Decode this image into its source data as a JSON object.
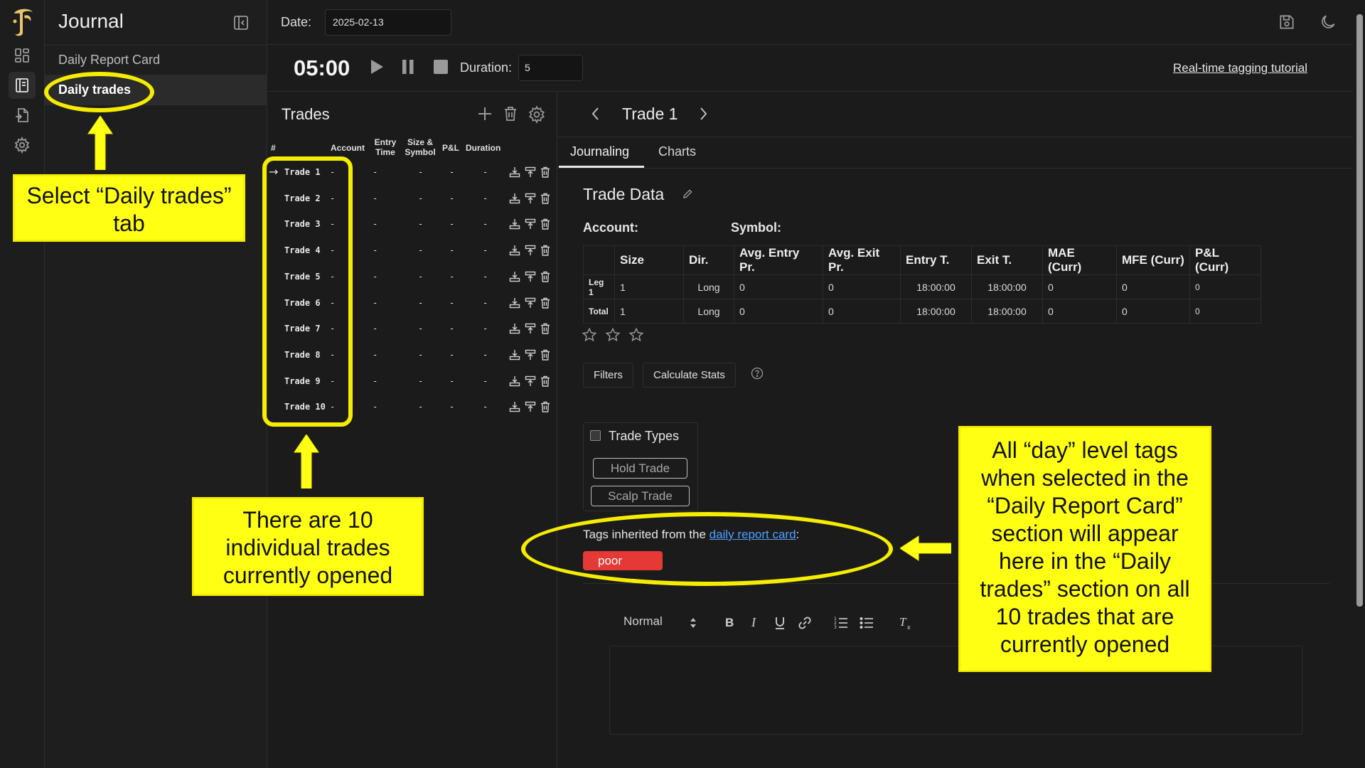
{
  "app": {
    "title": "Journal"
  },
  "sidebar": {
    "items": [
      {
        "label": "Daily Report Card"
      },
      {
        "label": "Daily trades"
      }
    ]
  },
  "topbar": {
    "date_label": "Date:",
    "date_value": "2025-02-13"
  },
  "timer": {
    "time": "05:00",
    "duration_label": "Duration:",
    "duration_value": "5",
    "tutorial_link": "Real-time tagging tutorial"
  },
  "trades_panel": {
    "title": "Trades",
    "columns": [
      "#",
      "Account",
      "Entry Time",
      "Size & Symbol",
      "P&L",
      "Duration"
    ],
    "rows": [
      {
        "name": "Trade 1",
        "account": "-",
        "entry": "-",
        "size": "-",
        "pnl": "-",
        "duration": "-"
      },
      {
        "name": "Trade 2",
        "account": "-",
        "entry": "-",
        "size": "-",
        "pnl": "-",
        "duration": "-"
      },
      {
        "name": "Trade 3",
        "account": "-",
        "entry": "-",
        "size": "-",
        "pnl": "-",
        "duration": "-"
      },
      {
        "name": "Trade 4",
        "account": "-",
        "entry": "-",
        "size": "-",
        "pnl": "-",
        "duration": "-"
      },
      {
        "name": "Trade 5",
        "account": "-",
        "entry": "-",
        "size": "-",
        "pnl": "-",
        "duration": "-"
      },
      {
        "name": "Trade 6",
        "account": "-",
        "entry": "-",
        "size": "-",
        "pnl": "-",
        "duration": "-"
      },
      {
        "name": "Trade 7",
        "account": "-",
        "entry": "-",
        "size": "-",
        "pnl": "-",
        "duration": "-"
      },
      {
        "name": "Trade 8",
        "account": "-",
        "entry": "-",
        "size": "-",
        "pnl": "-",
        "duration": "-"
      },
      {
        "name": "Trade 9",
        "account": "-",
        "entry": "-",
        "size": "-",
        "pnl": "-",
        "duration": "-"
      },
      {
        "name": "Trade 10",
        "account": "-",
        "entry": "-",
        "size": "-",
        "pnl": "-",
        "duration": "-"
      }
    ],
    "current_marker": "→"
  },
  "trade_detail": {
    "title": "Trade 1",
    "tabs": [
      "Journaling",
      "Charts"
    ],
    "section_title": "Trade Data",
    "account_label": "Account:",
    "symbol_label": "Symbol:",
    "table": {
      "headers": [
        "Size",
        "Dir.",
        "Avg. Entry Pr.",
        "Avg. Exit Pr.",
        "Entry T.",
        "Exit T.",
        "MAE (Curr)",
        "MFE (Curr)",
        "P&L (Curr)"
      ],
      "rows": [
        {
          "label": "Leg 1",
          "cells": [
            "1",
            "Long",
            "0",
            "0",
            "18:00:00",
            "18:00:00",
            "0",
            "0",
            "0"
          ]
        },
        {
          "label": "Total",
          "cells": [
            "1",
            "Long",
            "0",
            "0",
            "18:00:00",
            "18:00:00",
            "0",
            "0",
            "0"
          ]
        }
      ]
    },
    "rating": 0,
    "buttons": {
      "filters": "Filters",
      "calculate_stats": "Calculate Stats"
    },
    "trade_types": {
      "label": "Trade Types",
      "tags": [
        "Hold Trade",
        "Scalp Trade"
      ]
    },
    "inherited": {
      "prefix": "Tags inherited from the ",
      "link": "daily report card",
      "suffix": ":",
      "tags": [
        "poor"
      ]
    },
    "editor": {
      "format_value": "Normal"
    }
  },
  "annotations": {
    "select_tab": "Select “Daily trades” tab",
    "ten_trades": "There are 10 individual trades currently opened",
    "day_tags": "All “day” level tags when selected in the “Daily Report Card” section will appear here in the “Daily trades” section on all 10 trades that are currently opened"
  },
  "colors": {
    "background": "#1b1b1b",
    "annotation_yellow": "#ffff13",
    "tag_red": "#e53935",
    "link_blue": "#4ea1ff"
  }
}
